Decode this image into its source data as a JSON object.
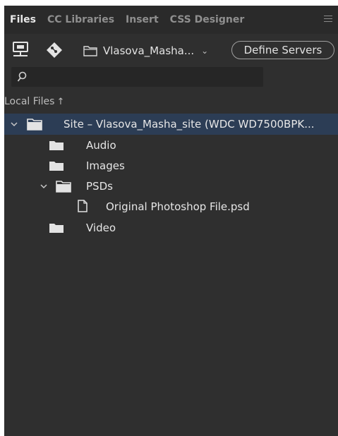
{
  "tabs": [
    {
      "label": "Files",
      "active": true
    },
    {
      "label": "CC Libraries",
      "active": false
    },
    {
      "label": "Insert",
      "active": false
    },
    {
      "label": "CSS Designer",
      "active": false
    }
  ],
  "toolbar": {
    "connect_icon": "connect-server-icon",
    "git_icon": "git-icon",
    "site_select": {
      "value": "Vlasova_Masha...",
      "icon": "folder-outline-icon"
    },
    "define_servers_label": "Define Servers"
  },
  "search": {
    "value": "",
    "placeholder": ""
  },
  "local_files": {
    "label": "Local Files",
    "sort_icon": "up-arrow-icon"
  },
  "tree": [
    {
      "name": "Site – Vlasova_Masha_site (WDC WD7500BPK...",
      "type": "site",
      "expanded": true,
      "selected": true
    },
    {
      "name": "Audio",
      "type": "folder"
    },
    {
      "name": "Images",
      "type": "folder"
    },
    {
      "name": "PSDs",
      "type": "folder",
      "expanded": true
    },
    {
      "name": "Original Photoshop File.psd",
      "type": "file"
    },
    {
      "name": "Video",
      "type": "folder"
    }
  ],
  "colors": {
    "panel_bg": "#2f2f2f",
    "tabbar_bg": "#2a2a2a",
    "selected_row": "#2c3d55",
    "text": "#e6e6e6"
  }
}
